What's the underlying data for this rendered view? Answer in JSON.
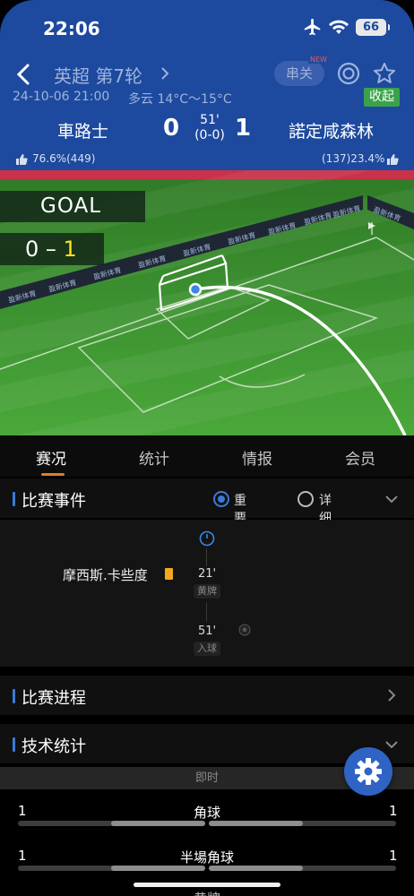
{
  "status_bar": {
    "time": "22:06",
    "battery": "66"
  },
  "header": {
    "league": "英超 第7轮",
    "parlay_label": "串关",
    "new_badge": "NEW",
    "date_time": "24-10-06 21:00",
    "weather": "多云 14°C～15°C",
    "collapse_label": "收起",
    "home_team": "車路士",
    "away_team": "諾定咸森林",
    "home_score": "0",
    "away_score": "1",
    "minute": "51'",
    "half_time_score": "(0-0)",
    "home_support": "76.6%(449)",
    "away_support": "(137)23.4%"
  },
  "pitch": {
    "goal_text": "GOAL",
    "score_home": "0 –",
    "score_away": "1",
    "ad_text": "盈新体育"
  },
  "tabs": [
    "赛况",
    "统计",
    "情报",
    "会员"
  ],
  "events": {
    "title": "比赛事件",
    "option_important": "重要事件",
    "option_detailed": "详细事件",
    "items": [
      {
        "player": "摩西斯.卡些度",
        "minute": "21'",
        "tag": "黄牌"
      },
      {
        "minute": "51'",
        "tag": "入球"
      }
    ]
  },
  "progress": {
    "title": "比赛进程"
  },
  "tech": {
    "title": "技术统计",
    "live_label": "即时",
    "rows": [
      {
        "name": "角球",
        "home": "1",
        "away": "1",
        "home_fraction": 0.5
      },
      {
        "name": "半場角球",
        "home": "1",
        "away": "1",
        "home_fraction": 0.5
      }
    ],
    "partial_label": "黄牌"
  },
  "colors": {
    "header_bg": "#1d4a9e",
    "pitch_green": "#3f9a2e",
    "accent_orange": "#e37b23",
    "yellow_card": "#f2a81d",
    "fab_blue": "#2f63c4"
  }
}
